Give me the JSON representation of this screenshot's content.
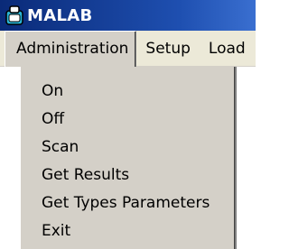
{
  "window": {
    "title": "MALAB",
    "icon": "app-icon"
  },
  "menubar": {
    "items": [
      {
        "label": "Administration"
      },
      {
        "label": "Setup"
      },
      {
        "label": "Load"
      }
    ]
  },
  "dropdown": {
    "items": [
      {
        "label": "On"
      },
      {
        "label": "Off"
      },
      {
        "label": "Scan"
      },
      {
        "label": "Get Results"
      },
      {
        "label": "Get Types Parameters"
      },
      {
        "label": "Exit"
      }
    ]
  },
  "colors": {
    "titlebar": "#0a2a78",
    "menu_bg": "#ece9d8",
    "dropdown_bg": "#d4d0c8"
  }
}
